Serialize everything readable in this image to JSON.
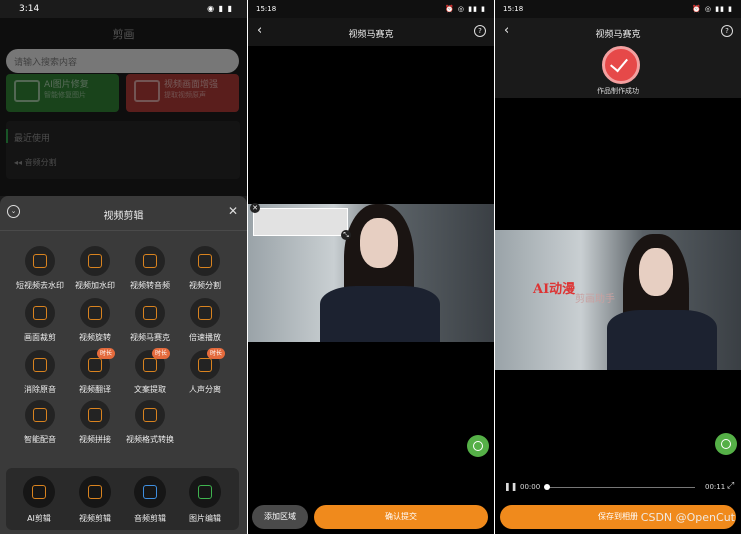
{
  "p1": {
    "status_time": "3:14",
    "app_title": "剪画",
    "search_placeholder": "请输入搜索内容",
    "banner_green_title": "AI图片修复",
    "banner_green_sub": "智能修复图片",
    "banner_red_title": "视频画面增强",
    "banner_red_sub": "提取视频原声",
    "recent_title": "最近使用",
    "recent_chip": "音频分割",
    "sheet_title": "视频剪辑",
    "tools": [
      {
        "label": "短视频去水印"
      },
      {
        "label": "视频加水印"
      },
      {
        "label": "视频转音频"
      },
      {
        "label": "视频分割"
      },
      {
        "label": "画面裁剪"
      },
      {
        "label": "视频旋转"
      },
      {
        "label": "视频马赛克"
      },
      {
        "label": "倍速播放"
      },
      {
        "label": "消除原音"
      },
      {
        "label": "视频翻译",
        "badge": "时长"
      },
      {
        "label": "文案提取",
        "badge": "时长"
      },
      {
        "label": "人声分离",
        "badge": "时长"
      },
      {
        "label": "智能配音"
      },
      {
        "label": "视频拼接"
      },
      {
        "label": "视频格式转换"
      }
    ],
    "bottom_tabs": [
      "AI剪辑",
      "视频剪辑",
      "音频剪辑",
      "图片编辑"
    ]
  },
  "p2": {
    "status_time": "15:18",
    "title": "视频马赛克",
    "add_area": "添加区域",
    "confirm": "确认提交"
  },
  "p3": {
    "status_time": "15:18",
    "title": "视频马赛克",
    "success": "作品制作成功",
    "overlay_ai": "AI动漫",
    "overlay_sub": "剪画助手",
    "time_start": "00:00",
    "time_end": "00:11",
    "save": "保存到相册",
    "watermark": "CSDN @OpenCut"
  },
  "colors": {
    "accent_orange": "#f08a1c",
    "success_red": "#e64949",
    "fab_green": "#55b047"
  }
}
